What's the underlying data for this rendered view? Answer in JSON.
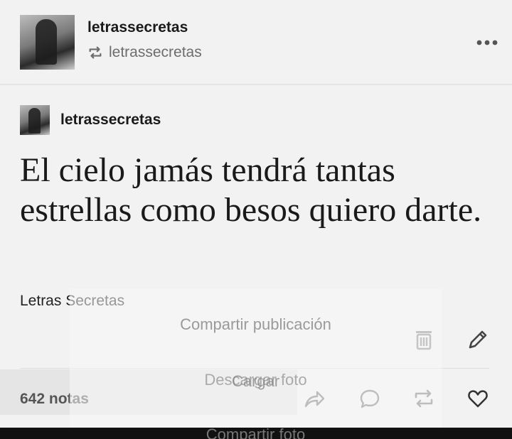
{
  "header": {
    "blog_name": "letrassecretas",
    "reblogged_from": "letrassecretas",
    "more_icon": "more-horizontal-icon"
  },
  "post": {
    "blog_name": "letrassecretas",
    "quote": "El cielo jamás tendrá tantas estrellas como besos quiero darte.",
    "source": "Letras Secretas",
    "notes": "642 notas"
  },
  "share_sheet": {
    "title": "Compartir publicación",
    "options": [
      "Descargar foto",
      "Cargar",
      "Compartir foto"
    ]
  },
  "actions": [
    "trash-icon",
    "edit-icon",
    "share-icon",
    "comment-icon",
    "reblog-icon",
    "like-icon"
  ],
  "colors": {
    "background": "#f2f2f2",
    "text": "#1a1a1a",
    "muted": "#6d6d6d"
  }
}
